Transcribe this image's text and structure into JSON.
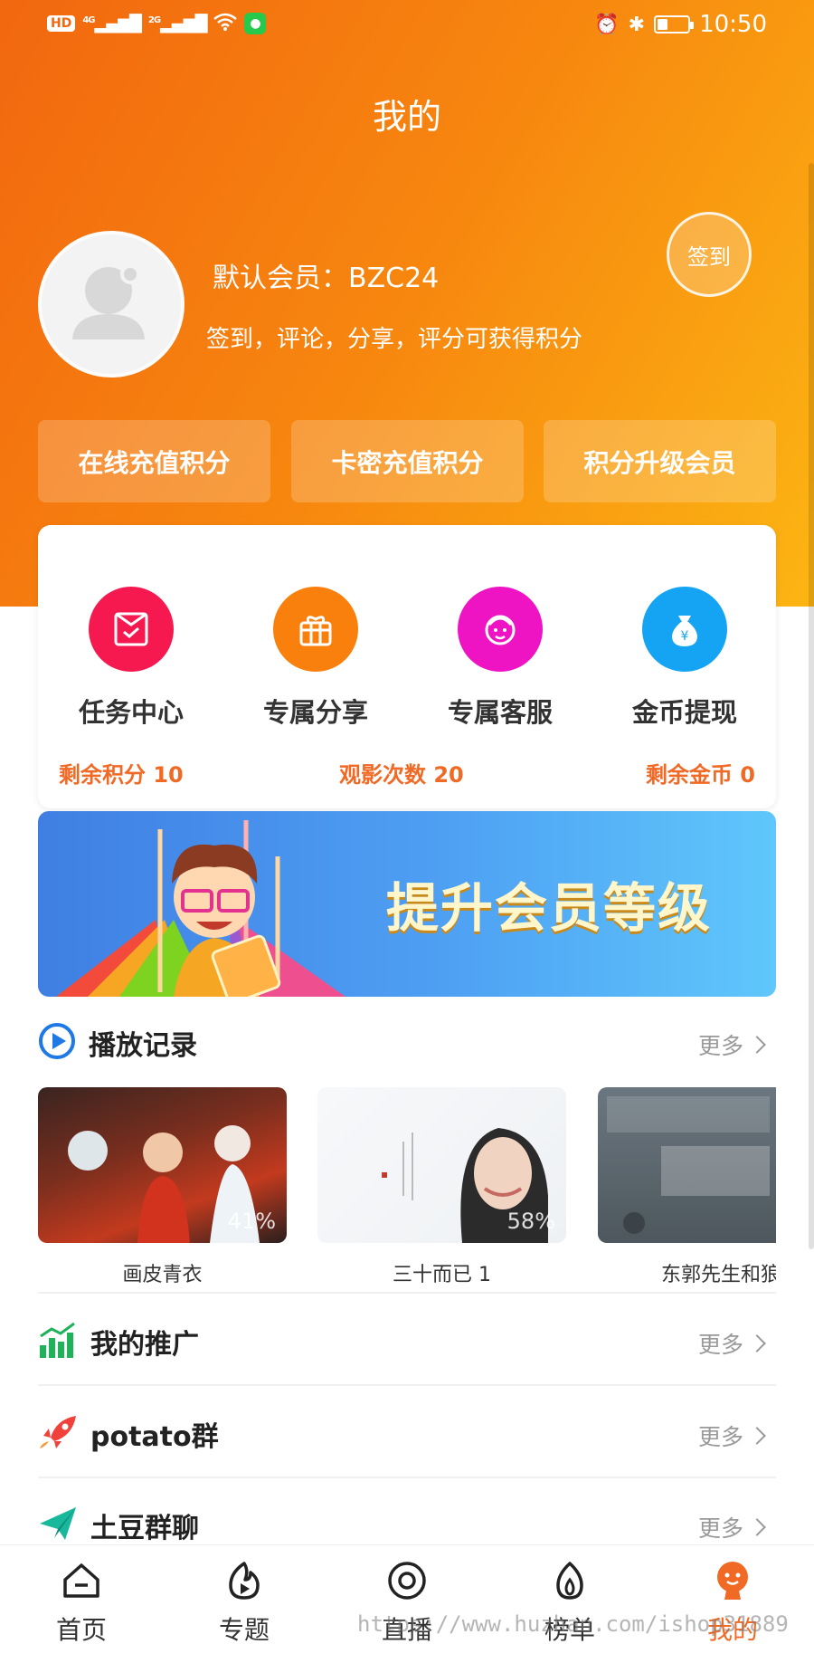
{
  "status_bar": {
    "hd_badge": "HD",
    "net1": "4G",
    "net2": "2G",
    "time": "10:50",
    "battery_level": 0.3
  },
  "header": {
    "title": "我的"
  },
  "profile": {
    "member_label": "默认会员：BZC24",
    "hint": "签到，评论，分享，评分可获得积分",
    "checkin_label": "签到"
  },
  "actions": [
    {
      "label": "在线充值积分"
    },
    {
      "label": "卡密充值积分"
    },
    {
      "label": "积分升级会员"
    }
  ],
  "quick_entries": [
    {
      "label": "任务中心",
      "icon": "task-icon",
      "color": "#f5194f"
    },
    {
      "label": "专属分享",
      "icon": "gift-icon",
      "color": "#f9800c"
    },
    {
      "label": "专属客服",
      "icon": "service-icon",
      "color": "#ee13c3"
    },
    {
      "label": "金币提现",
      "icon": "money-bag-icon",
      "color": "#15a4f3"
    }
  ],
  "stats": {
    "points": "剩余积分 10",
    "views": "观影次数 20",
    "coins": "剩余金币 0"
  },
  "banner": {
    "text": "提升会员等级"
  },
  "sections": {
    "history": {
      "title": "播放记录",
      "more": "更多"
    },
    "promotion": {
      "title": "我的推广",
      "more": "更多"
    },
    "potato_group": {
      "title": "potato群",
      "more": "更多"
    },
    "group_chat": {
      "title": "土豆群聊",
      "more": "更多"
    }
  },
  "history_items": [
    {
      "title": "画皮青衣",
      "progress": "41%"
    },
    {
      "title": "三十而已 1",
      "progress": "58%"
    },
    {
      "title": "东郭先生和狼",
      "progress": ""
    }
  ],
  "tabs": [
    {
      "label": "首页",
      "icon": "home-icon"
    },
    {
      "label": "专题",
      "icon": "topic-icon"
    },
    {
      "label": "直播",
      "icon": "live-icon"
    },
    {
      "label": "榜单",
      "icon": "ranking-icon"
    },
    {
      "label": "我的",
      "icon": "profile-icon",
      "active": true
    }
  ],
  "watermark": "https://www.huzhan.com/ishop31889",
  "colors": {
    "accent_orange": "#f06a26",
    "hero_start": "#f2670f",
    "hero_end": "#fcb513"
  }
}
